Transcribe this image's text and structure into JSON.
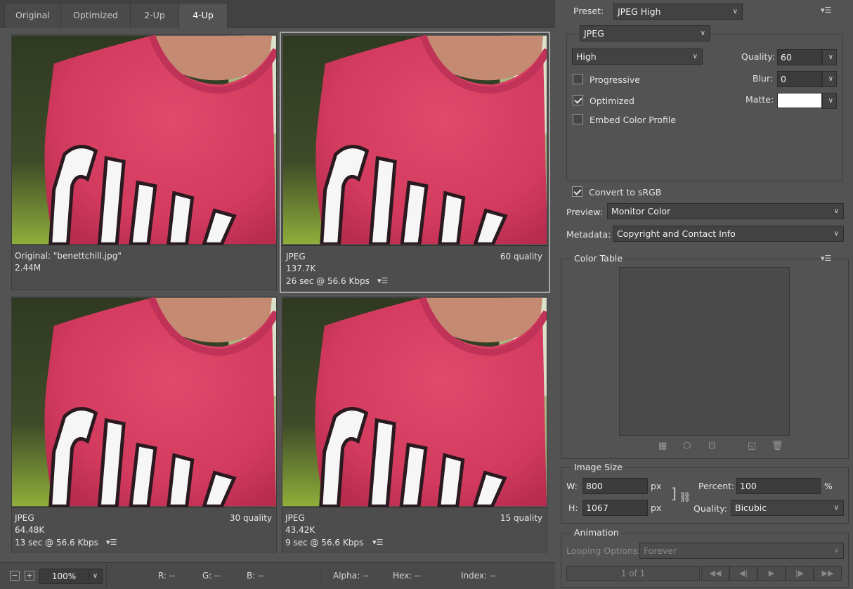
{
  "tabs": [
    "Original",
    "Optimized",
    "2-Up",
    "4-Up"
  ],
  "panes": [
    {
      "line1": "Original: \"benettchill.jpg\"",
      "line2": "2.44M",
      "line3": "",
      "quality": ""
    },
    {
      "line1": "JPEG",
      "line2": "137.7K",
      "line3": "26 sec @ 56.6 Kbps",
      "quality": "60 quality"
    },
    {
      "line1": "JPEG",
      "line2": "64.48K",
      "line3": "13 sec @ 56.6 Kbps",
      "quality": "30 quality"
    },
    {
      "line1": "JPEG",
      "line2": "43.42K",
      "line3": "9 sec @ 56.6 Kbps",
      "quality": "15 quality"
    }
  ],
  "status": {
    "zoom": "100%",
    "r": "R: --",
    "g": "G: --",
    "b": "B: --",
    "alpha": "Alpha: --",
    "hex": "Hex: --",
    "index": "Index: --"
  },
  "settings": {
    "preset_label": "Preset:",
    "preset": "JPEG High",
    "format": "JPEG",
    "quality_level": "High",
    "quality_label": "Quality:",
    "quality": "60",
    "blur_label": "Blur:",
    "blur": "0",
    "matte_label": "Matte:",
    "matte_color": "#ffffff",
    "progressive": "Progressive",
    "optimized": "Optimized",
    "embed": "Embed Color Profile",
    "convert": "Convert to sRGB",
    "preview_label": "Preview:",
    "preview": "Monitor Color",
    "metadata_label": "Metadata:",
    "metadata": "Copyright and Contact Info"
  },
  "color_table": {
    "title": "Color Table"
  },
  "image_size": {
    "title": "Image Size",
    "w_label": "W:",
    "w": "800",
    "h_label": "H:",
    "h": "1067",
    "unit": "px",
    "percent_label": "Percent:",
    "percent": "100",
    "percent_unit": "%",
    "quality_label": "Quality:",
    "quality": "Bicubic"
  },
  "animation": {
    "title": "Animation",
    "looping_label": "Looping Options:",
    "looping": "Forever",
    "frame": "1 of 1"
  }
}
